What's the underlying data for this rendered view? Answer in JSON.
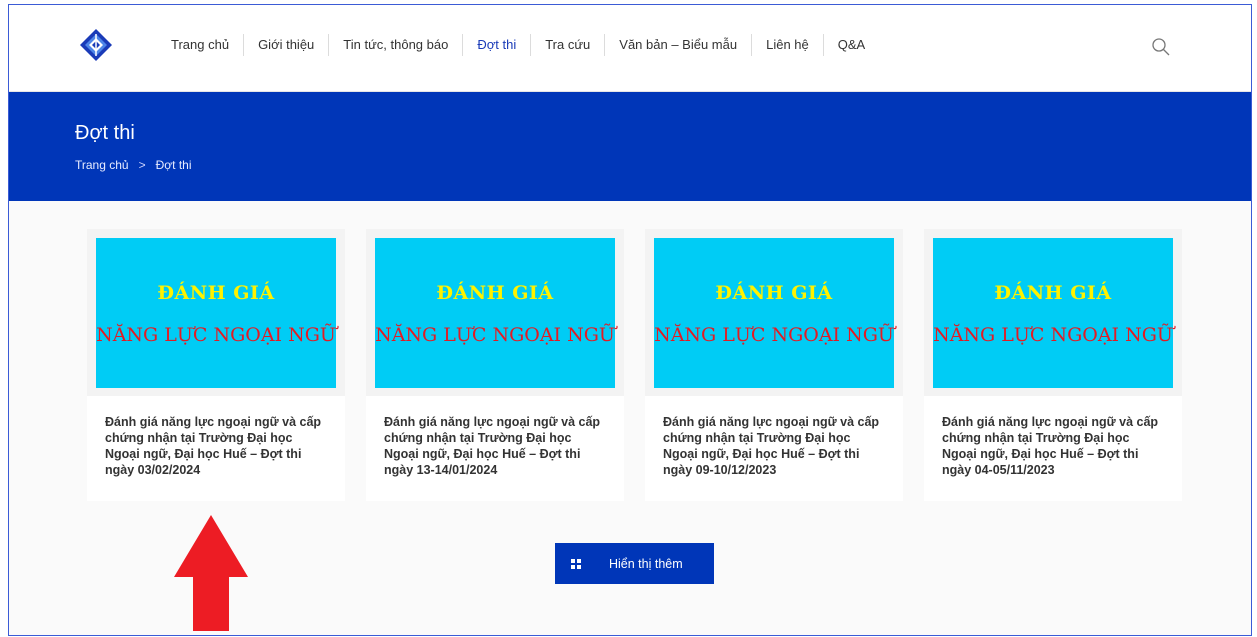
{
  "header": {
    "nav": [
      {
        "label": "Trang chủ",
        "active": false
      },
      {
        "label": "Giới thiệu",
        "active": false
      },
      {
        "label": "Tin tức, thông báo",
        "active": false
      },
      {
        "label": "Đợt thi",
        "active": true
      },
      {
        "label": "Tra cứu",
        "active": false
      },
      {
        "label": "Văn bản – Biểu mẫu",
        "active": false
      },
      {
        "label": "Liên hệ",
        "active": false
      },
      {
        "label": "Q&A",
        "active": false
      }
    ],
    "logo_icon": "diamond-logo-icon",
    "search_icon": "search-icon"
  },
  "banner": {
    "title": "Đợt thi",
    "breadcrumb": {
      "home": "Trang chủ",
      "separator": ">",
      "current": "Đợt thi"
    }
  },
  "cards": [
    {
      "thumb_line1": "ĐÁNH GIÁ",
      "thumb_line2": "NĂNG LỰC NGOẠI NGỮ",
      "title": "Đánh giá năng lực ngoại ngữ và cấp chứng nhận tại Trường Đại học Ngoại ngữ, Đại học Huế – Đợt thi ngày 03/02/2024"
    },
    {
      "thumb_line1": "ĐÁNH GIÁ",
      "thumb_line2": "NĂNG LỰC NGOẠI NGỮ",
      "title": "Đánh giá năng lực ngoại ngữ và cấp chứng nhận tại Trường Đại học Ngoại ngữ, Đại học Huế – Đợt thi ngày 13-14/01/2024"
    },
    {
      "thumb_line1": "ĐÁNH GIÁ",
      "thumb_line2": "NĂNG LỰC NGOẠI NGỮ",
      "title": "Đánh giá năng lực ngoại ngữ và cấp chứng nhận tại Trường Đại học Ngoại ngữ, Đại học Huế – Đợt thi ngày 09-10/12/2023"
    },
    {
      "thumb_line1": "ĐÁNH GIÁ",
      "thumb_line2": "NĂNG LỰC NGOẠI NGỮ",
      "title": "Đánh giá năng lực ngoại ngữ và cấp chứng nhận tại Trường Đại học Ngoại ngữ, Đại học Huế – Đợt thi ngày 04-05/11/2023"
    }
  ],
  "show_more": {
    "label": "Hiển thị thêm",
    "icon": "grid-icon"
  },
  "annotation": {
    "icon": "red-up-arrow-icon"
  },
  "colors": {
    "brand_blue": "#0036b8",
    "nav_active": "#1a3bb8",
    "thumb_bg": "#00ccf5",
    "thumb_line1": "#fff200",
    "thumb_line2": "#e31b23",
    "arrow_red": "#ed1c24"
  }
}
